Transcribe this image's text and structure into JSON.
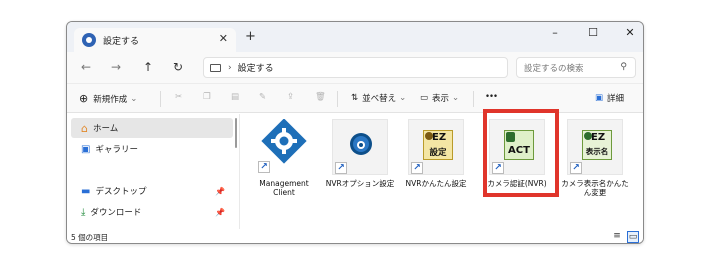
{
  "window": {
    "tab_title": "設定する",
    "tab_close": "✕",
    "new_tab": "+",
    "minimize": "–",
    "maximize": "☐",
    "close": "✕"
  },
  "address": {
    "back": "←",
    "forward": "→",
    "up": "↑",
    "refresh": "↻",
    "chevron": "›",
    "path": "設定する",
    "search_placeholder": "設定するの検索",
    "search_icon": "⚲"
  },
  "toolbar": {
    "new_icon": "⊕",
    "new_label": "新規作成",
    "new_chevron": "⌄",
    "sort_icon": "⇅",
    "sort_label": "並べ替え",
    "sort_chevron": "⌄",
    "view_icon": "▭",
    "view_label": "表示",
    "view_chevron": "⌄",
    "more": "•••",
    "details_icon": "▣",
    "details_label": "詳細",
    "cut_icon": "✂",
    "copy_icon": "❐",
    "paste_icon": "▤",
    "rename_icon": "✎",
    "share_icon": "⇪",
    "delete_icon": "🗑"
  },
  "sidebar": {
    "items": [
      {
        "label": "ホーム",
        "icon": "home-icon",
        "glyph": "⌂",
        "color": "#e2892b"
      },
      {
        "label": "ギャラリー",
        "icon": "gallery-icon",
        "glyph": "▣",
        "color": "#2a6fd6"
      },
      {
        "label": "デスクトップ",
        "icon": "desktop-icon",
        "glyph": "▬",
        "color": "#2a6fd6",
        "pin": "📌"
      },
      {
        "label": "ダウンロード",
        "icon": "download-icon",
        "glyph": "⤓",
        "color": "#1f8a3a",
        "pin": "📌"
      }
    ]
  },
  "files": [
    {
      "label": "Management Client",
      "icon": "gear-icon"
    },
    {
      "label": "NVRオプション設定",
      "icon": "nvr-icon"
    },
    {
      "label": "NVRかんたん設定",
      "icon": "ez-setup-icon",
      "ez": "EZ",
      "jp": "設定"
    },
    {
      "label": "カメラ認証(NVR)",
      "icon": "act-icon",
      "jp": "ACT"
    },
    {
      "label": "カメラ表示名かんたん変更",
      "icon": "ez-rename-icon",
      "ez": "EZ",
      "jp": "表示名"
    }
  ],
  "shortcut_glyph": "↗",
  "status": {
    "count": "5 個の項目",
    "list_view": "≡",
    "tile_view": "▭"
  },
  "colors": {
    "accent": "#2a6fd6",
    "highlight": "#e0352b",
    "gear": "#1e6fb8"
  }
}
